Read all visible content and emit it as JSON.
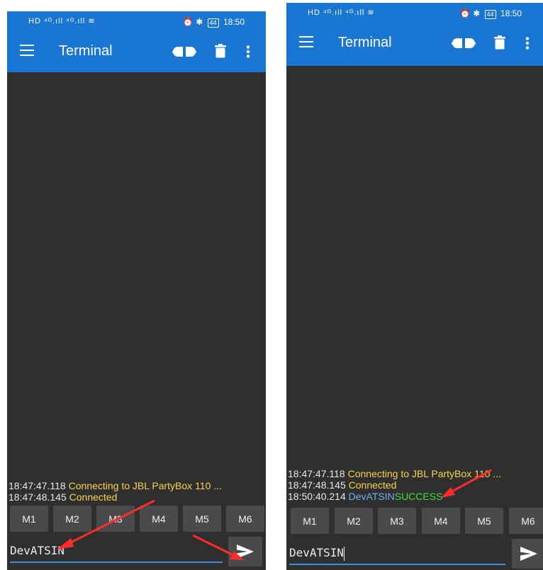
{
  "status_bar": {
    "left_icons": "HD ⁴ᴳ.ıll ⁴ᴳ.ıll ≋",
    "time": "18:50",
    "battery": "44"
  },
  "app": {
    "title": "Terminal"
  },
  "icons": {
    "menu": "hamburger-menu-icon",
    "connect": "plug-disconnect-icon",
    "clear": "trash-icon",
    "more": "more-vert-icon",
    "send": "send-icon"
  },
  "colors": {
    "app_bar": "#1976d2",
    "background": "#2f2f2f",
    "timestamp": "#e8e8e8",
    "status_text": "#f7d44a",
    "sent_text": "#6fb0f0",
    "received_text": "#3fe03f",
    "input_underline": "#3f8fe0",
    "annotation_arrow": "#ff2a2a"
  },
  "macros": [
    "M1",
    "M2",
    "M3",
    "M4",
    "M5",
    "M6"
  ],
  "left_screen": {
    "log": [
      {
        "time": "18:47:47.118",
        "text": "Connecting to JBL PartyBox 110 ..."
      },
      {
        "time": "18:47:48.145",
        "text": "Connected"
      }
    ],
    "input_value": "DevATSIN"
  },
  "right_screen": {
    "log": [
      {
        "time": "18:47:47.118",
        "text": "Connecting to JBL PartyBox 110 ..."
      },
      {
        "time": "18:47:48.145",
        "text": "Connected"
      },
      {
        "time": "18:50:40.214",
        "sent": "DevATSIN",
        "received": "SUCCESS"
      }
    ],
    "input_value": "DevATSIN"
  }
}
